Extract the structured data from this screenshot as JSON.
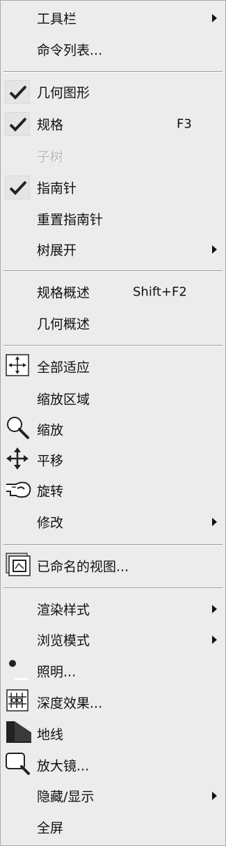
{
  "menu": {
    "toolbar": "工具栏",
    "command_list": "命令列表...",
    "geometry": "几何图形",
    "spec": "规格",
    "spec_shortcut": "F3",
    "subtree": "子树",
    "compass": "指南针",
    "reset_compass": "重置指南针",
    "expand_tree": "树展开",
    "spec_overview": "规格概述",
    "spec_overview_shortcut": "Shift+F2",
    "geometry_overview": "几何概述",
    "fit_all": "全部适应",
    "zoom_area": "缩放区域",
    "zoom": "缩放",
    "pan": "平移",
    "rotate": "旋转",
    "modify": "修改",
    "named_views": "已命名的视图...",
    "render_style": "渲染样式",
    "navigation_mode": "浏览模式",
    "lighting": "照明...",
    "depth_effect": "深度效果...",
    "ground": "地线",
    "magnifier": "放大镜...",
    "hide_show": "隐藏/显示",
    "full_screen": "全屏"
  },
  "icons": {
    "check": "checkmark-icon",
    "fit_all": "fit-all-icon",
    "zoom": "magnifier-icon",
    "pan": "pan-arrows-icon",
    "rotate": "rotate-hand-icon",
    "named_views": "named-views-icon",
    "lighting": "light-icon",
    "depth_effect": "depth-effect-icon",
    "ground": "ground-icon",
    "magnifier": "magnifier-glass-icon"
  }
}
